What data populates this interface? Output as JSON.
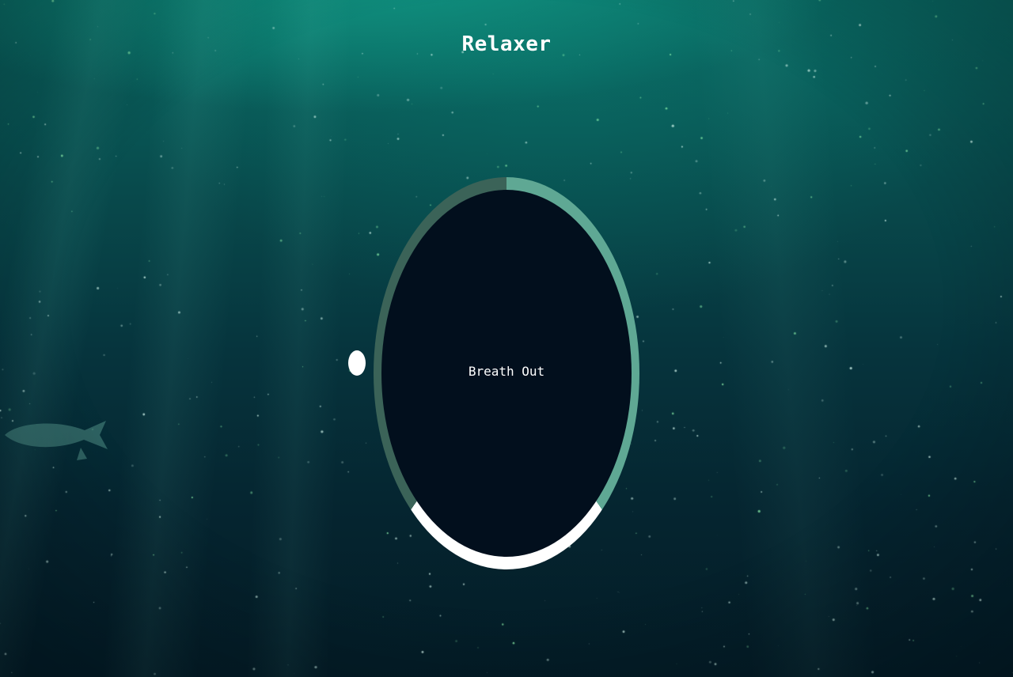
{
  "app": {
    "title": "Relaxer"
  },
  "breath": {
    "status_text": "Breath Out",
    "ring_colors": {
      "breathe_in": "#5fa894",
      "hold": "#ffffff",
      "breathe_out": "#3b6358"
    },
    "inner_color": "#020f1d"
  },
  "icons": {
    "pointer": "white-dot-indicator",
    "fish": "fish-silhouette"
  }
}
